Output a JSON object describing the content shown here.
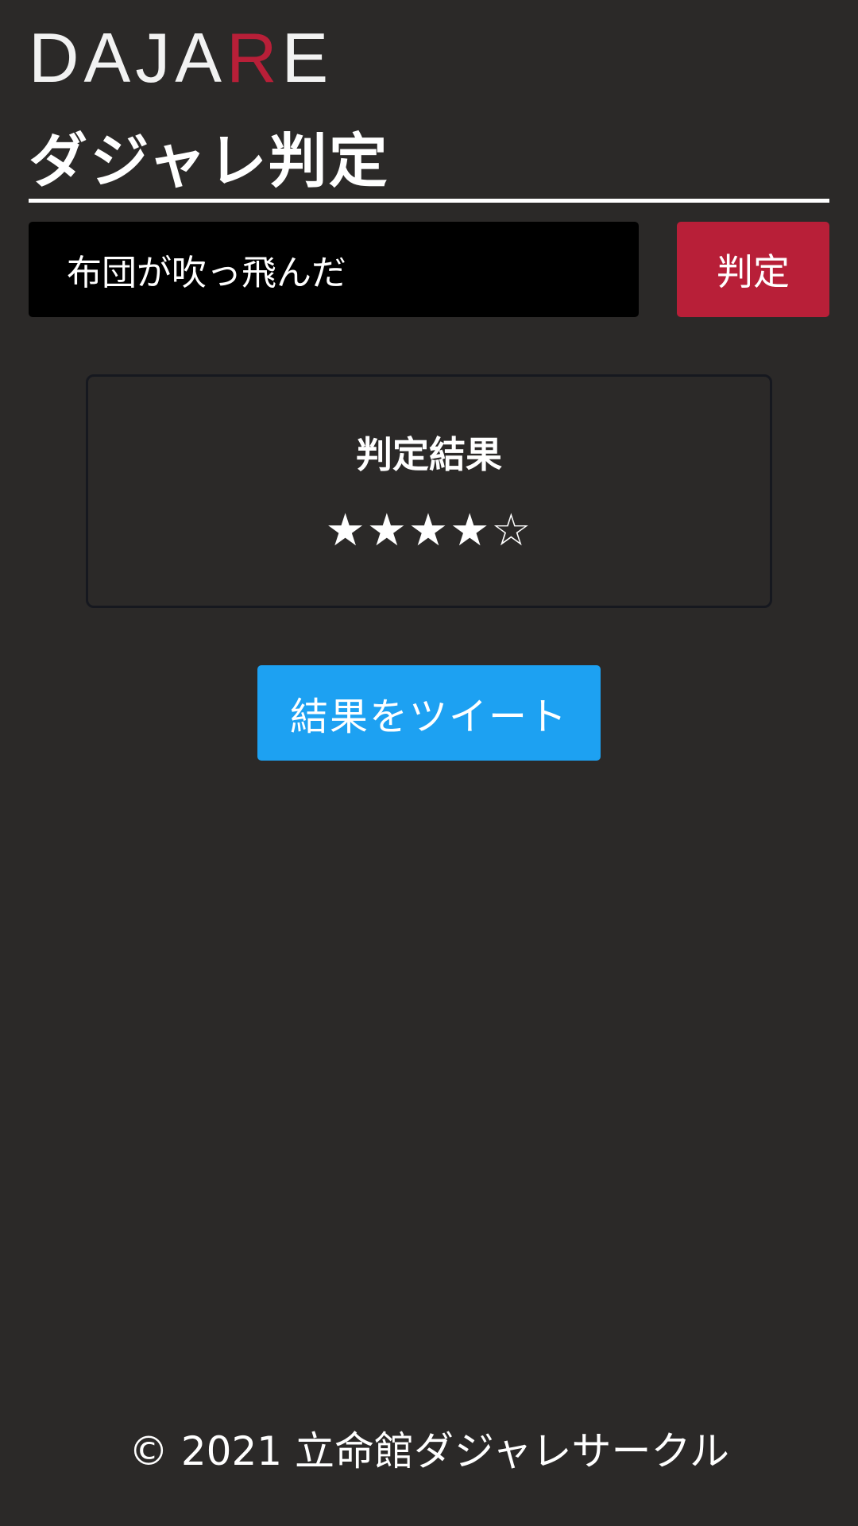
{
  "header": {
    "logo_main": "DAJA",
    "logo_accent": "R",
    "logo_end": "E"
  },
  "page": {
    "title": "ダジャレ判定"
  },
  "form": {
    "input_value": "布団が吹っ飛んだ",
    "judge_label": "判定"
  },
  "result": {
    "title": "判定結果",
    "stars": "★★★★☆",
    "rating": 4,
    "rating_max": 5
  },
  "tweet": {
    "label": "結果をツイート"
  },
  "footer": {
    "copyright": "© 2021 立命館ダジャレサークル"
  },
  "colors": {
    "background": "#2b2928",
    "accent_red": "#b81f38",
    "twitter_blue": "#1da1f2",
    "input_bg": "#000000"
  }
}
